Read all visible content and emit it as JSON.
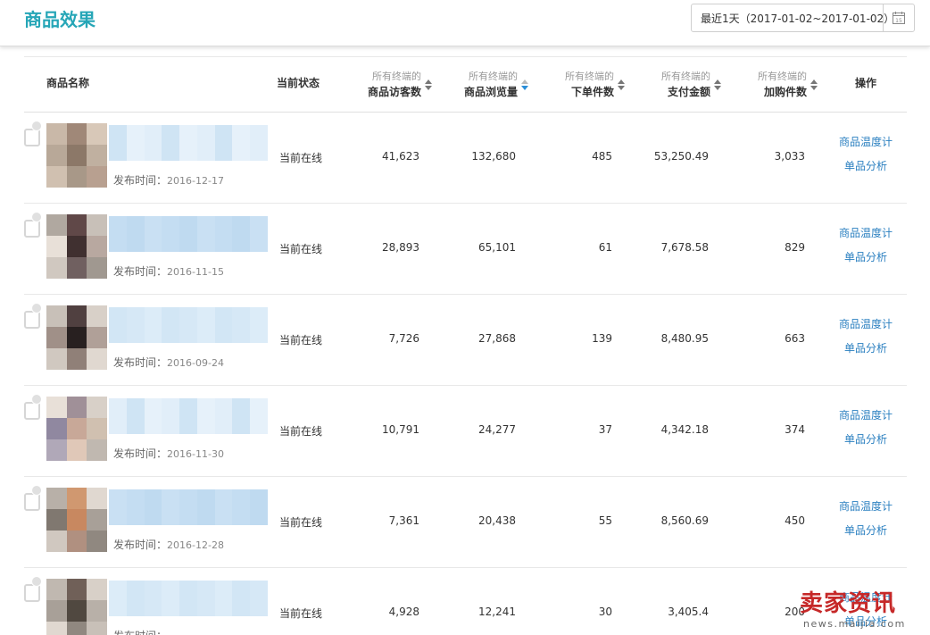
{
  "header": {
    "title": "商品效果",
    "date_range": "最近1天（2017-01-02~2017-01-02）",
    "calendar_day": "15"
  },
  "table": {
    "columns": {
      "name": "商品名称",
      "status": "当前状态",
      "visitors": {
        "sub": "所有终端的",
        "main": "商品访客数"
      },
      "views": {
        "sub": "所有终端的",
        "main": "商品浏览量"
      },
      "orders": {
        "sub": "所有终端的",
        "main": "下单件数"
      },
      "payment": {
        "sub": "所有终端的",
        "main": "支付金额"
      },
      "cart": {
        "sub": "所有终端的",
        "main": "加购件数"
      },
      "action": "操作"
    },
    "publish_label": "发布时间：",
    "rows": [
      {
        "date": "2016-12-17",
        "status": "当前在线",
        "visitors": "41,623",
        "views": "132,680",
        "orders": "485",
        "payment": "53,250.49",
        "cart": "3,033",
        "op1": "商品温度计",
        "op2": "单品分析"
      },
      {
        "date": "2016-11-15",
        "status": "当前在线",
        "visitors": "28,893",
        "views": "65,101",
        "orders": "61",
        "payment": "7,678.58",
        "cart": "829",
        "op1": "商品温度计",
        "op2": "单品分析"
      },
      {
        "date": "2016-09-24",
        "status": "当前在线",
        "visitors": "7,726",
        "views": "27,868",
        "orders": "139",
        "payment": "8,480.95",
        "cart": "663",
        "op1": "商品温度计",
        "op2": "单品分析"
      },
      {
        "date": "2016-11-30",
        "status": "当前在线",
        "visitors": "10,791",
        "views": "24,277",
        "orders": "37",
        "payment": "4,342.18",
        "cart": "374",
        "op1": "商品温度计",
        "op2": "单品分析"
      },
      {
        "date": "2016-12-28",
        "status": "当前在线",
        "visitors": "7,361",
        "views": "20,438",
        "orders": "55",
        "payment": "8,560.69",
        "cart": "450",
        "op1": "商品温度计",
        "op2": "单品分析"
      },
      {
        "date": "",
        "status": "当前在线",
        "visitors": "4,928",
        "views": "12,241",
        "orders": "30",
        "payment": "3,405.4",
        "cart": "200",
        "op1": "商品温度计",
        "op2": "单品分析"
      }
    ]
  },
  "watermark": {
    "big": "卖家资讯",
    "small": "news.maijia.com"
  },
  "colors": {
    "accent": "#26a6b7",
    "link": "#2a7fc0",
    "sort_active": "#2b8ed8",
    "watermark": "#c62828"
  }
}
